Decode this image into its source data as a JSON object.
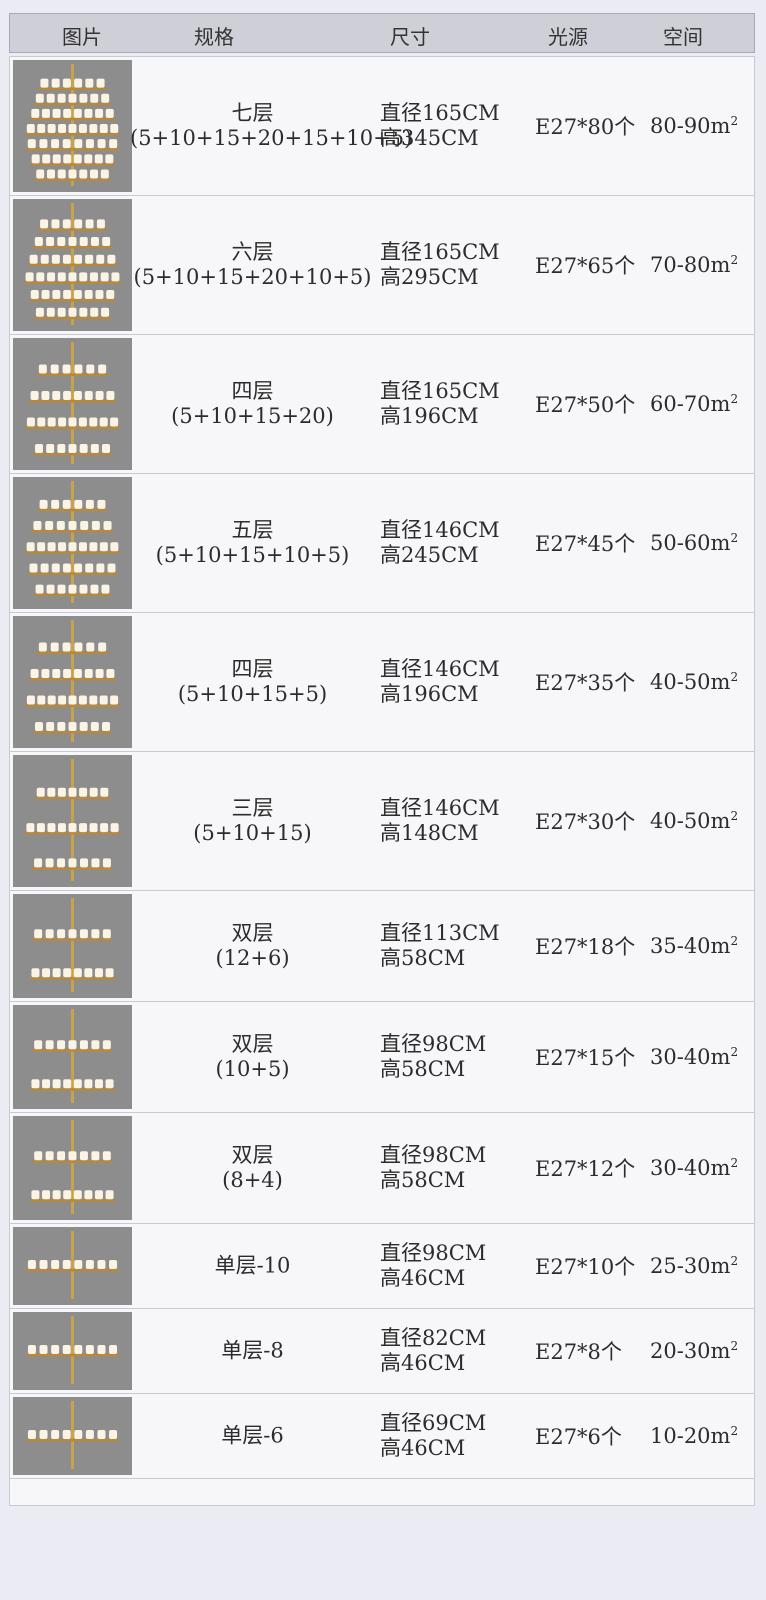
{
  "header": [
    "图片",
    "规格",
    "尺寸",
    "光源",
    "空间"
  ],
  "rows": [
    {
      "tiers": 7,
      "spec1": "七层",
      "spec2": "(5+10+15+20+15+10+5)",
      "d": "直径165CM",
      "h": "高345CM",
      "light": "E27*80个",
      "space": "80-90m",
      "sq": "2"
    },
    {
      "tiers": 6,
      "spec1": "六层",
      "spec2": "(5+10+15+20+10+5)",
      "d": "直径165CM",
      "h": "高295CM",
      "light": "E27*65个",
      "space": "70-80m",
      "sq": "2"
    },
    {
      "tiers": 4,
      "spec1": "四层",
      "spec2": "(5+10+15+20)",
      "d": "直径165CM",
      "h": "高196CM",
      "light": "E27*50个",
      "space": "60-70m",
      "sq": "2"
    },
    {
      "tiers": 5,
      "spec1": "五层",
      "spec2": "(5+10+15+10+5)",
      "d": "直径146CM",
      "h": "高245CM",
      "light": "E27*45个",
      "space": "50-60m",
      "sq": "2"
    },
    {
      "tiers": 4,
      "spec1": "四层",
      "spec2": "(5+10+15+5)",
      "d": "直径146CM",
      "h": "高196CM",
      "light": "E27*35个",
      "space": "40-50m",
      "sq": "2"
    },
    {
      "tiers": 3,
      "spec1": "三层",
      "spec2": "(5+10+15)",
      "d": "直径146CM",
      "h": "高148CM",
      "light": "E27*30个",
      "space": "40-50m",
      "sq": "2"
    },
    {
      "tiers": 2,
      "spec1": "双层",
      "spec2": "(12+6)",
      "d": "直径113CM",
      "h": "高58CM",
      "light": "E27*18个",
      "space": "35-40m",
      "sq": "2"
    },
    {
      "tiers": 2,
      "spec1": "双层",
      "spec2": "(10+5)",
      "d": "直径98CM",
      "h": "高58CM",
      "light": "E27*15个",
      "space": "30-40m",
      "sq": "2"
    },
    {
      "tiers": 2,
      "spec1": "双层",
      "spec2": "(8+4)",
      "d": "直径98CM",
      "h": "高58CM",
      "light": "E27*12个",
      "space": "30-40m",
      "sq": "2"
    },
    {
      "tiers": 1,
      "spec1": "单层-10",
      "spec2": "",
      "d": "直径98CM",
      "h": "高46CM",
      "light": "E27*10个",
      "space": "25-30m",
      "sq": "2"
    },
    {
      "tiers": 1,
      "spec1": "单层-8",
      "spec2": "",
      "d": "直径82CM",
      "h": "高46CM",
      "light": "E27*8个",
      "space": "20-30m",
      "sq": "2"
    },
    {
      "tiers": 1,
      "spec1": "单层-6",
      "spec2": "",
      "d": "直径69CM",
      "h": "高46CM",
      "light": "E27*6个",
      "space": "10-20m",
      "sq": "2"
    }
  ]
}
